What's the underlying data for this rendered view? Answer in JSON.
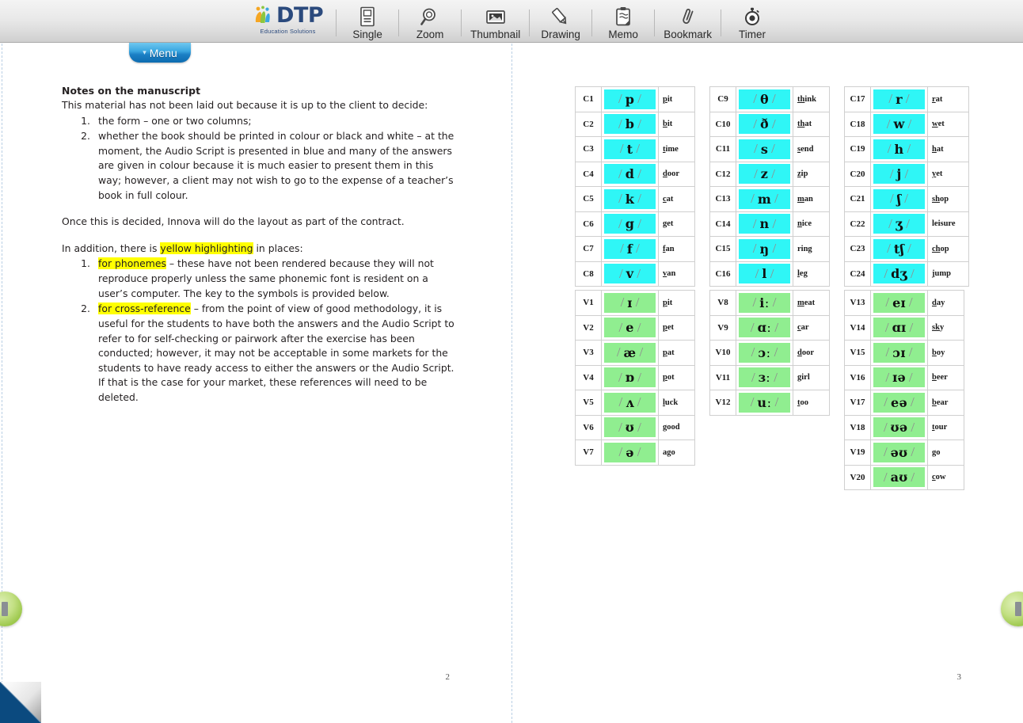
{
  "app": {
    "brand": "DTP",
    "brand_sub": "Education Solutions",
    "menu_label": "Menu"
  },
  "toolbar": {
    "items": [
      {
        "label": "Single",
        "icon": "single-page-icon"
      },
      {
        "label": "Zoom",
        "icon": "magnifier-icon"
      },
      {
        "label": "Thumbnail",
        "icon": "thumbnail-image-icon"
      },
      {
        "label": "Drawing",
        "icon": "pencil-icon"
      },
      {
        "label": "Memo",
        "icon": "clipboard-note-icon"
      },
      {
        "label": "Bookmark",
        "icon": "paperclip-icon"
      },
      {
        "label": "Timer",
        "icon": "stopwatch-icon"
      }
    ]
  },
  "navigation": {
    "prev_label": "previous-page",
    "next_label": "next-page",
    "corner_label": "page-curl"
  },
  "colors": {
    "consonant_cell": "#2ff6f6",
    "vowel_cell": "#90ee90",
    "highlight": "#ffff00",
    "accent_tab": "#1b7fc4",
    "nav_button": "#9fc94f",
    "curl_triangle": "#0b4a7f"
  },
  "left_page": {
    "page_number": "2",
    "heading": "Notes on the manuscript",
    "intro": "This material has not been laid out because it is up to the client to decide:",
    "list_1": [
      {
        "num": "1.",
        "text": "the form – one or two columns;"
      },
      {
        "num": "2.",
        "text": "whether the book should be printed in colour or black and white – at the moment, the Audio Script is presented in blue and many of the answers are given in colour because it is much easier to present them in this way; however, a client may not wish to go to the expense of a teacher’s book in full colour."
      }
    ],
    "para_2": "Once this is decided, Innova will do the layout as part of the contract.",
    "para_3_before": "In addition, there is ",
    "para_3_highlight": "yellow highlighting",
    "para_3_after": " in places:",
    "list_2": [
      {
        "num": "1.",
        "highlight": "for phonemes",
        "text": " – these have not been rendered because they will not reproduce properly unless the same phonemic font is resident on a user’s computer. The key to the symbols is provided below."
      },
      {
        "num": "2.",
        "highlight": "for cross-reference",
        "text": " – from the point of view of good methodology, it is useful for the students to have both the answers and the Audio Script to refer to for self-checking or pairwork after the exercise has been conducted; however, it may not be acceptable in some markets for the students to have ready access to either the answers or the Audio Script. If that is the case for your market, these references will need to be deleted."
      }
    ]
  },
  "right_page": {
    "page_number": "3",
    "consonants_col1": [
      {
        "code": "C1",
        "symbol": "p",
        "word_pre": "p",
        "word_post": "it"
      },
      {
        "code": "C2",
        "symbol": "b",
        "word_pre": "b",
        "word_post": "it"
      },
      {
        "code": "C3",
        "symbol": "t",
        "word_pre": "t",
        "word_post": "ime"
      },
      {
        "code": "C4",
        "symbol": "d",
        "word_pre": "d",
        "word_post": "oor"
      },
      {
        "code": "C5",
        "symbol": "k",
        "word_pre": "c",
        "word_post": "at"
      },
      {
        "code": "C6",
        "symbol": "g",
        "word_pre": "",
        "word_post": "get"
      },
      {
        "code": "C7",
        "symbol": "f",
        "word_pre": "f",
        "word_post": "an"
      },
      {
        "code": "C8",
        "symbol": "v",
        "word_pre": "v",
        "word_post": "an"
      }
    ],
    "consonants_col2": [
      {
        "code": "C9",
        "symbol": "θ",
        "word_pre": "th",
        "word_post": "ink"
      },
      {
        "code": "C10",
        "symbol": "ð",
        "word_pre": "th",
        "word_post": "at"
      },
      {
        "code": "C11",
        "symbol": "s",
        "word_pre": "s",
        "word_post": "end"
      },
      {
        "code": "C12",
        "symbol": "z",
        "word_pre": "z",
        "word_post": "ip"
      },
      {
        "code": "C13",
        "symbol": "m",
        "word_pre": "m",
        "word_post": "an"
      },
      {
        "code": "C14",
        "symbol": "n",
        "word_pre": "n",
        "word_post": "ice"
      },
      {
        "code": "C15",
        "symbol": "ŋ",
        "word_pre": "",
        "word_post": "ring"
      },
      {
        "code": "C16",
        "symbol": "l",
        "word_pre": "l",
        "word_post": "eg"
      }
    ],
    "consonants_col3": [
      {
        "code": "C17",
        "symbol": "r",
        "word_pre": "r",
        "word_post": "at"
      },
      {
        "code": "C18",
        "symbol": "w",
        "word_pre": "w",
        "word_post": "et"
      },
      {
        "code": "C19",
        "symbol": "h",
        "word_pre": "h",
        "word_post": "at"
      },
      {
        "code": "C20",
        "symbol": "j",
        "word_pre": "y",
        "word_post": "et"
      },
      {
        "code": "C21",
        "symbol": "ʃ",
        "word_pre": "sh",
        "word_post": "op"
      },
      {
        "code": "C22",
        "symbol": "ʒ",
        "word_pre": "",
        "word_post": "leisure"
      },
      {
        "code": "C23",
        "symbol": "tʃ",
        "word_pre": "ch",
        "word_post": "op"
      },
      {
        "code": "C24",
        "symbol": "dʒ",
        "word_pre": "j",
        "word_post": "ump"
      }
    ],
    "vowels_col1": [
      {
        "code": "V1",
        "symbol": "ɪ",
        "word_pre": "p",
        "word_post": "it"
      },
      {
        "code": "V2",
        "symbol": "e",
        "word_pre": "p",
        "word_post": "et"
      },
      {
        "code": "V3",
        "symbol": "æ",
        "word_pre": "p",
        "word_post": "at"
      },
      {
        "code": "V4",
        "symbol": "ɒ",
        "word_pre": "p",
        "word_post": "ot"
      },
      {
        "code": "V5",
        "symbol": "ʌ",
        "word_pre": "l",
        "word_post": "uck"
      },
      {
        "code": "V6",
        "symbol": "ʊ",
        "word_pre": "g",
        "word_post": "ood"
      },
      {
        "code": "V7",
        "symbol": "ə",
        "word_pre": "",
        "word_post": "ago"
      }
    ],
    "vowels_col2": [
      {
        "code": "V8",
        "symbol": "iː",
        "word_pre": "m",
        "word_post": "eat"
      },
      {
        "code": "V9",
        "symbol": "ɑː",
        "word_pre": "c",
        "word_post": "ar"
      },
      {
        "code": "V10",
        "symbol": "ɔː",
        "word_pre": "d",
        "word_post": "oor"
      },
      {
        "code": "V11",
        "symbol": "ɜː",
        "word_pre": "",
        "word_post": "girl"
      },
      {
        "code": "V12",
        "symbol": "uː",
        "word_pre": "t",
        "word_post": "oo"
      }
    ],
    "vowels_col3": [
      {
        "code": "V13",
        "symbol": "eɪ",
        "word_pre": "d",
        "word_post": "ay"
      },
      {
        "code": "V14",
        "symbol": "ɑɪ",
        "word_pre": "sk",
        "word_post": "y"
      },
      {
        "code": "V15",
        "symbol": "ɔɪ",
        "word_pre": "b",
        "word_post": "oy"
      },
      {
        "code": "V16",
        "symbol": "ɪə",
        "word_pre": "b",
        "word_post": "eer"
      },
      {
        "code": "V17",
        "symbol": "eə",
        "word_pre": "b",
        "word_post": "ear"
      },
      {
        "code": "V18",
        "symbol": "ʊə",
        "word_pre": "t",
        "word_post": "our"
      },
      {
        "code": "V19",
        "symbol": "əʊ",
        "word_pre": "",
        "word_post": "go"
      },
      {
        "code": "V20",
        "symbol": "aʊ",
        "word_pre": "c",
        "word_post": "ow"
      }
    ]
  }
}
